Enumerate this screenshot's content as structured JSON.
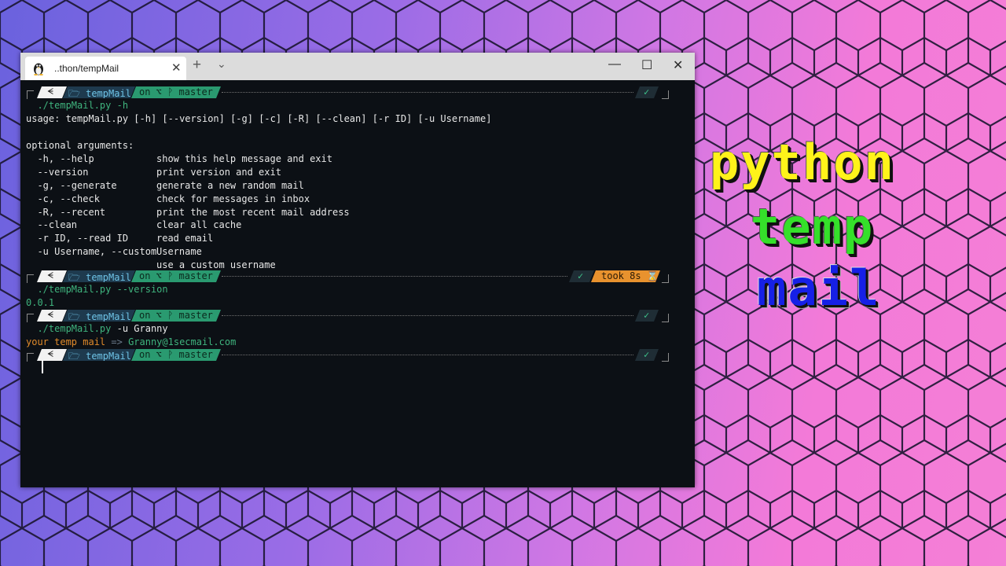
{
  "window": {
    "tab_title": "..thon/tempMail",
    "tab_icon": "linux-penguin-icon",
    "close_tab_glyph": "✕",
    "new_tab_glyph": "+",
    "dropdown_glyph": "⌄",
    "minimize_glyph": "—",
    "maximize_glyph": "☐",
    "close_glyph": "✕"
  },
  "prompt": {
    "os_glyph": "ᗕ",
    "directory": "🗁 tempMail",
    "git": "on ⌥ ᚹ master",
    "status_ok": "✓",
    "took": "took 8s ⌛"
  },
  "terminal": {
    "cmd1": "./tempMail.py -h",
    "usage": "usage: tempMail.py [-h] [--version] [-g] [-c] [-R] [--clean] [-r ID] [-u Username]",
    "optional_header": "optional arguments:",
    "options": [
      {
        "flag": "  -h, --help",
        "desc": "show this help message and exit"
      },
      {
        "flag": "  --version",
        "desc": "print version and exit"
      },
      {
        "flag": "  -g, --generate",
        "desc": "generate a new random mail"
      },
      {
        "flag": "  -c, --check",
        "desc": "check for messages in inbox"
      },
      {
        "flag": "  -R, --recent",
        "desc": "print the most recent mail address"
      },
      {
        "flag": "  --clean",
        "desc": "clear all cache"
      },
      {
        "flag": "  -r ID, --read ID",
        "desc": "read email"
      },
      {
        "flag": "  -u Username, --custom",
        "desc": "Username"
      },
      {
        "flag": "",
        "desc": "use a custom username"
      }
    ],
    "cmd2": "./tempMail.py --version",
    "version_output": "0.0.1",
    "cmd3_prefix": "./tempMail.py",
    "cmd3_args": " -u Granny",
    "mail_label": "your temp mail",
    "mail_arrow": " => ",
    "mail_value": "Granny@1secmail.com"
  },
  "overlay": {
    "line1": "python",
    "line2": "temp",
    "line3": "mail"
  },
  "colors": {
    "terminal_bg": "#0c1015",
    "prompt_dir_bg": "#1e3a4e",
    "prompt_git_bg": "#2a9a70",
    "prompt_took_bg": "#e8922e",
    "python_text": "#fff31a",
    "temp_text": "#35e02a",
    "mail_text": "#1620e6"
  }
}
